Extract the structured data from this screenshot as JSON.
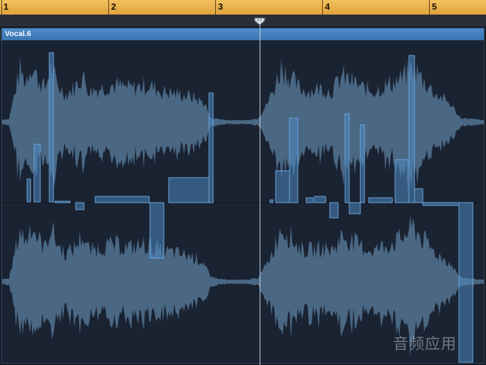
{
  "ruler": {
    "bars": [
      {
        "num": "1"
      },
      {
        "num": "2"
      },
      {
        "num": "3"
      },
      {
        "num": "4"
      },
      {
        "num": "5"
      }
    ]
  },
  "region": {
    "name": "Vocal.6",
    "color": "#3f7fbf"
  },
  "watermark": "音频应用",
  "colors": {
    "waveform": "#4a6783",
    "flex_marker": "#4f88bf",
    "playhead": "#c9d3df"
  }
}
